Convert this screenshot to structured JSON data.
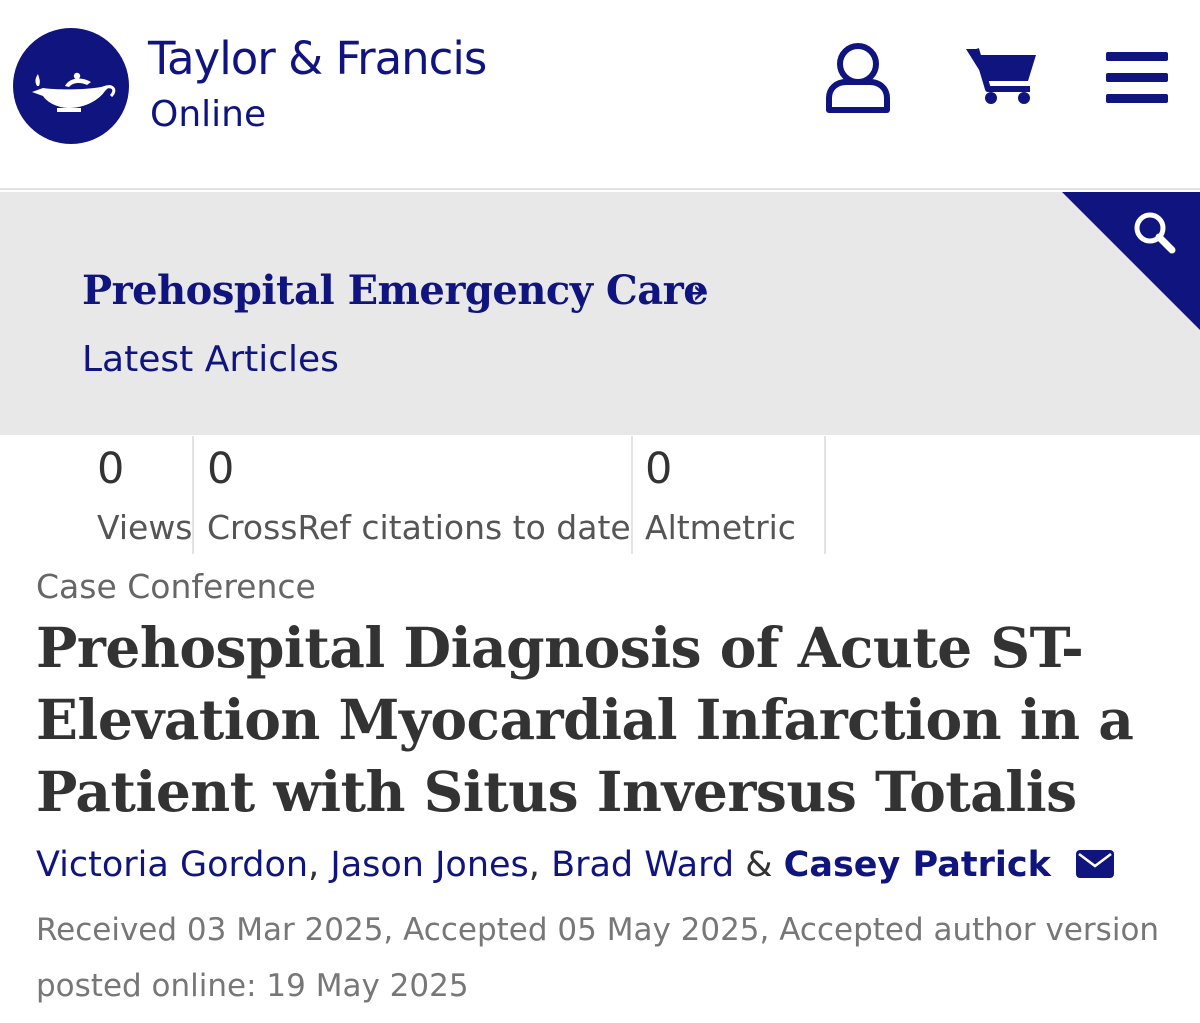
{
  "header": {
    "brand_name": "Taylor & Francis",
    "brand_sub": "Online",
    "icons": [
      "lamp-logo-icon",
      "user-icon",
      "cart-icon",
      "menu-icon"
    ]
  },
  "journal": {
    "title": "Prehospital Emergency Care",
    "chevron": "›",
    "section": "Latest Articles",
    "search_icon": "search-icon"
  },
  "metrics": [
    {
      "value": "0",
      "label": "Views"
    },
    {
      "value": "0",
      "label": "CrossRef citations to date"
    },
    {
      "value": "0",
      "label": "Altmetric"
    }
  ],
  "article": {
    "type": "Case Conference",
    "title": "Prehospital Diagnosis of Acute ST-Elevation Myocardial Infarction in a Patient with Situs Inversus Totalis",
    "authors": [
      {
        "name": "Victoria Gordon",
        "sep": ","
      },
      {
        "name": "Jason Jones",
        "sep": ","
      },
      {
        "name": "Brad Ward",
        "sep": "&"
      },
      {
        "name": "Casey Patrick",
        "sep": ""
      }
    ],
    "dates": "Received 03 Mar 2025, Accepted 05 May 2025, Accepted author version posted online: 19 May 2025"
  },
  "colors": {
    "brand": "#10147e",
    "banner_bg": "#e8e8e8",
    "text": "#333333"
  }
}
